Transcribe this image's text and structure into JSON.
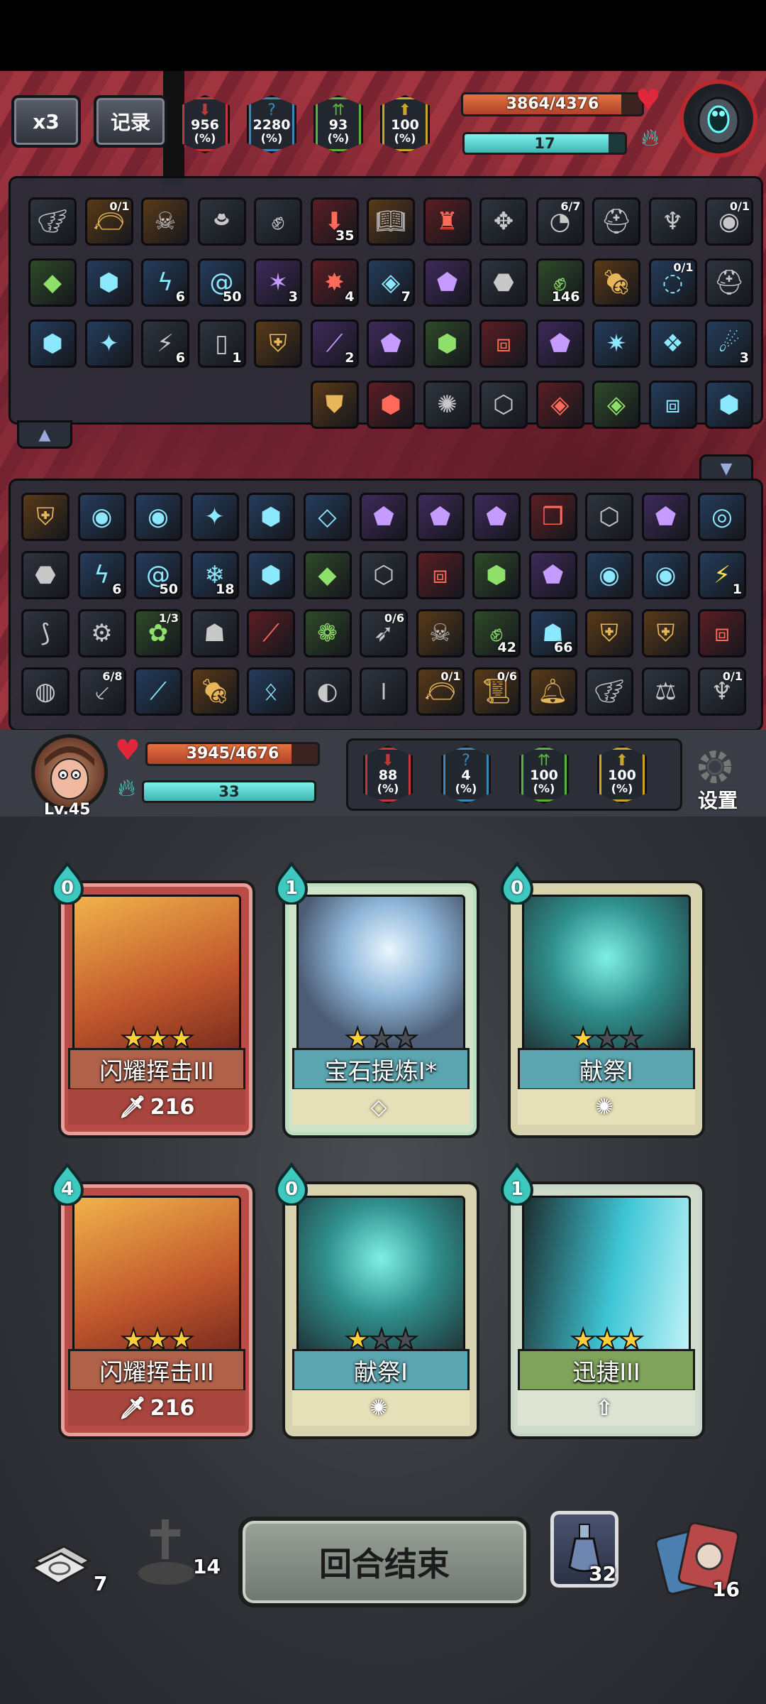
{
  "hud": {
    "speed_label": "x3",
    "record_label": "记录",
    "enemy_stats": [
      {
        "value": "956",
        "unit": "(%)",
        "color": "#c03838",
        "icon": "attack-down-icon"
      },
      {
        "value": "2280",
        "unit": "(%)",
        "color": "#3a88b5",
        "icon": "question-icon"
      },
      {
        "value": "93",
        "unit": "(%)",
        "color": "#5ab23a",
        "icon": "defense-up-icon"
      },
      {
        "value": "100",
        "unit": "(%)",
        "color": "#c9a62a",
        "icon": "arrow-up-icon"
      }
    ],
    "enemy_hp": "3864/4376",
    "enemy_hp_fraction": 0.883,
    "enemy_energy": "17",
    "enemy_energy_fraction": 0.9
  },
  "enemy_relics": {
    "rows": [
      [
        {
          "icon": "wings-icon"
        },
        {
          "icon": "bag-icon",
          "frac": "0/1"
        },
        {
          "icon": "skull-pot-icon"
        },
        {
          "icon": "hat-icon"
        },
        {
          "icon": "gauntlet-icon"
        },
        {
          "icon": "red-arrow-icon",
          "count": "35"
        },
        {
          "icon": "book-icon"
        },
        {
          "icon": "red-totem-icon"
        },
        {
          "icon": "crossbow-icon"
        },
        {
          "icon": "clock-icon",
          "frac": "6/7"
        },
        {
          "icon": "helmet-icon"
        },
        {
          "icon": "horn-icon"
        },
        {
          "icon": "orb-icon",
          "frac": "0/1"
        }
      ],
      [
        {
          "icon": "green-gem-icon"
        },
        {
          "icon": "blue-gem-icon"
        },
        {
          "icon": "lightning-icon",
          "count": "6"
        },
        {
          "icon": "vortex-icon",
          "count": "50"
        },
        {
          "icon": "purple-burst-icon",
          "count": "3"
        },
        {
          "icon": "fire-burst-icon",
          "count": "4"
        },
        {
          "icon": "crystal-icon",
          "count": "7"
        },
        {
          "icon": "purple-crystal-icon"
        },
        {
          "icon": "ruby-icon"
        },
        {
          "icon": "green-fist-icon",
          "count": "146"
        },
        {
          "icon": "meat-icon"
        },
        {
          "icon": "portal-icon",
          "frac": "0/1"
        },
        {
          "icon": "helmet-icon"
        }
      ],
      [
        {
          "icon": "blue-gem-icon"
        },
        {
          "icon": "ice-shard-icon"
        },
        {
          "icon": "light-slash-icon",
          "count": "6"
        },
        {
          "icon": "paper-icon",
          "count": "1"
        },
        {
          "icon": "golden-shield-icon"
        },
        {
          "icon": "purple-slash-icon",
          "count": "2"
        },
        {
          "icon": "purple-gem-icon"
        },
        {
          "icon": "green-shell-icon"
        },
        {
          "icon": "red-mirror-icon"
        },
        {
          "icon": "purple-crystal-icon"
        },
        {
          "icon": "ice-star-icon"
        },
        {
          "icon": "blue-cube-icon"
        },
        {
          "icon": "comet-icon",
          "count": "3"
        }
      ],
      [
        {
          "icon": "shield-icon"
        },
        {
          "icon": "red-gem-icon"
        },
        {
          "icon": "spark-icon"
        },
        {
          "icon": "dark-gem-icon"
        },
        {
          "icon": "red-crystal-icon"
        },
        {
          "icon": "green-crystal-icon"
        },
        {
          "icon": "ice-mirror-icon"
        },
        {
          "icon": "blue-gem-icon"
        }
      ]
    ]
  },
  "player_relics": {
    "rows": [
      [
        {
          "icon": "golden-shield-icon"
        },
        {
          "icon": "blue-eye-icon"
        },
        {
          "icon": "blue-eye-icon"
        },
        {
          "icon": "ice-shard-icon"
        },
        {
          "icon": "blue-gem-icon"
        },
        {
          "icon": "ice-crystal-icon"
        },
        {
          "icon": "purple-gem-icon"
        },
        {
          "icon": "rainbow-gem-icon"
        },
        {
          "icon": "purple-crystal-icon"
        },
        {
          "icon": "red-cube-icon"
        },
        {
          "icon": "dark-gem-icon"
        },
        {
          "icon": "purple-gem-icon"
        },
        {
          "icon": "teal-eye-icon"
        }
      ],
      [
        {
          "icon": "ruby-icon"
        },
        {
          "icon": "lightning-icon",
          "count": "6"
        },
        {
          "icon": "vortex-icon",
          "count": "50"
        },
        {
          "icon": "snowflake-icon",
          "count": "18"
        },
        {
          "icon": "blue-gem-icon"
        },
        {
          "icon": "green-gem-icon"
        },
        {
          "icon": "dark-gem-icon"
        },
        {
          "icon": "red-mirror-icon"
        },
        {
          "icon": "green-shell-icon"
        },
        {
          "icon": "purple-gem-icon"
        },
        {
          "icon": "blue-eye-icon"
        },
        {
          "icon": "blue-eye-icon"
        },
        {
          "icon": "bolt-icon",
          "count": "1"
        }
      ],
      [
        {
          "icon": "claw-icon"
        },
        {
          "icon": "robot-icon"
        },
        {
          "icon": "plant-icon",
          "frac": "1/3"
        },
        {
          "icon": "mask-icon"
        },
        {
          "icon": "red-blade-icon"
        },
        {
          "icon": "green-slime-icon"
        },
        {
          "icon": "rocket-icon",
          "frac": "0/6"
        },
        {
          "icon": "skull-pot-icon"
        },
        {
          "icon": "green-fist-icon",
          "count": "42"
        },
        {
          "icon": "teal-mask-icon",
          "count": "66"
        },
        {
          "icon": "golden-shield-icon"
        },
        {
          "icon": "golden-shield-icon"
        },
        {
          "icon": "red-mirror-icon"
        }
      ],
      [
        {
          "icon": "nest-icon"
        },
        {
          "icon": "knife-icon",
          "frac": "6/8"
        },
        {
          "icon": "blue-blade-icon"
        },
        {
          "icon": "meat-icon"
        },
        {
          "icon": "blue-rune-icon"
        },
        {
          "icon": "disc-icon"
        },
        {
          "icon": "bullet-icon"
        },
        {
          "icon": "bag-icon",
          "frac": "0/1"
        },
        {
          "icon": "scroll-icon",
          "frac": "0/6"
        },
        {
          "icon": "bell-icon"
        },
        {
          "icon": "wings-icon"
        },
        {
          "icon": "scales-icon"
        },
        {
          "icon": "horn-icon",
          "frac": "0/1"
        }
      ]
    ]
  },
  "player": {
    "level": "Lv.45",
    "hp": "3945/4676",
    "hp_fraction": 0.844,
    "energy": "33",
    "energy_fraction": 1.0,
    "stats": [
      {
        "value": "88",
        "unit": "(%)",
        "color": "#c03838",
        "icon": "attack-down-icon"
      },
      {
        "value": "4",
        "unit": "(%)",
        "color": "#3a88b5",
        "icon": "question-icon"
      },
      {
        "value": "100",
        "unit": "(%)",
        "color": "#5ab23a",
        "icon": "defense-up-icon"
      },
      {
        "value": "100",
        "unit": "(%)",
        "color": "#c9a62a",
        "icon": "arrow-up-icon"
      }
    ],
    "settings_label": "设置"
  },
  "hand": [
    {
      "name": "闪耀挥击III",
      "cost": "0",
      "stars": 3,
      "value": "216",
      "type": "attack"
    },
    {
      "name": "宝石提炼I*",
      "cost": "1",
      "stars": 1,
      "value": "",
      "type": "gem"
    },
    {
      "name": "献祭I",
      "cost": "0",
      "stars": 1,
      "value": "",
      "type": "sacrifice"
    },
    {
      "name": "闪耀挥击III",
      "cost": "4",
      "stars": 3,
      "value": "216",
      "type": "attack"
    },
    {
      "name": "献祭I",
      "cost": "0",
      "stars": 1,
      "value": "",
      "type": "sacrifice"
    },
    {
      "name": "迅捷III",
      "cost": "1",
      "stars": 3,
      "value": "",
      "type": "agility"
    }
  ],
  "piles": {
    "draw": "7",
    "grave": "14",
    "potion": "32",
    "discard": "16"
  },
  "end_turn_label": "回合结束"
}
